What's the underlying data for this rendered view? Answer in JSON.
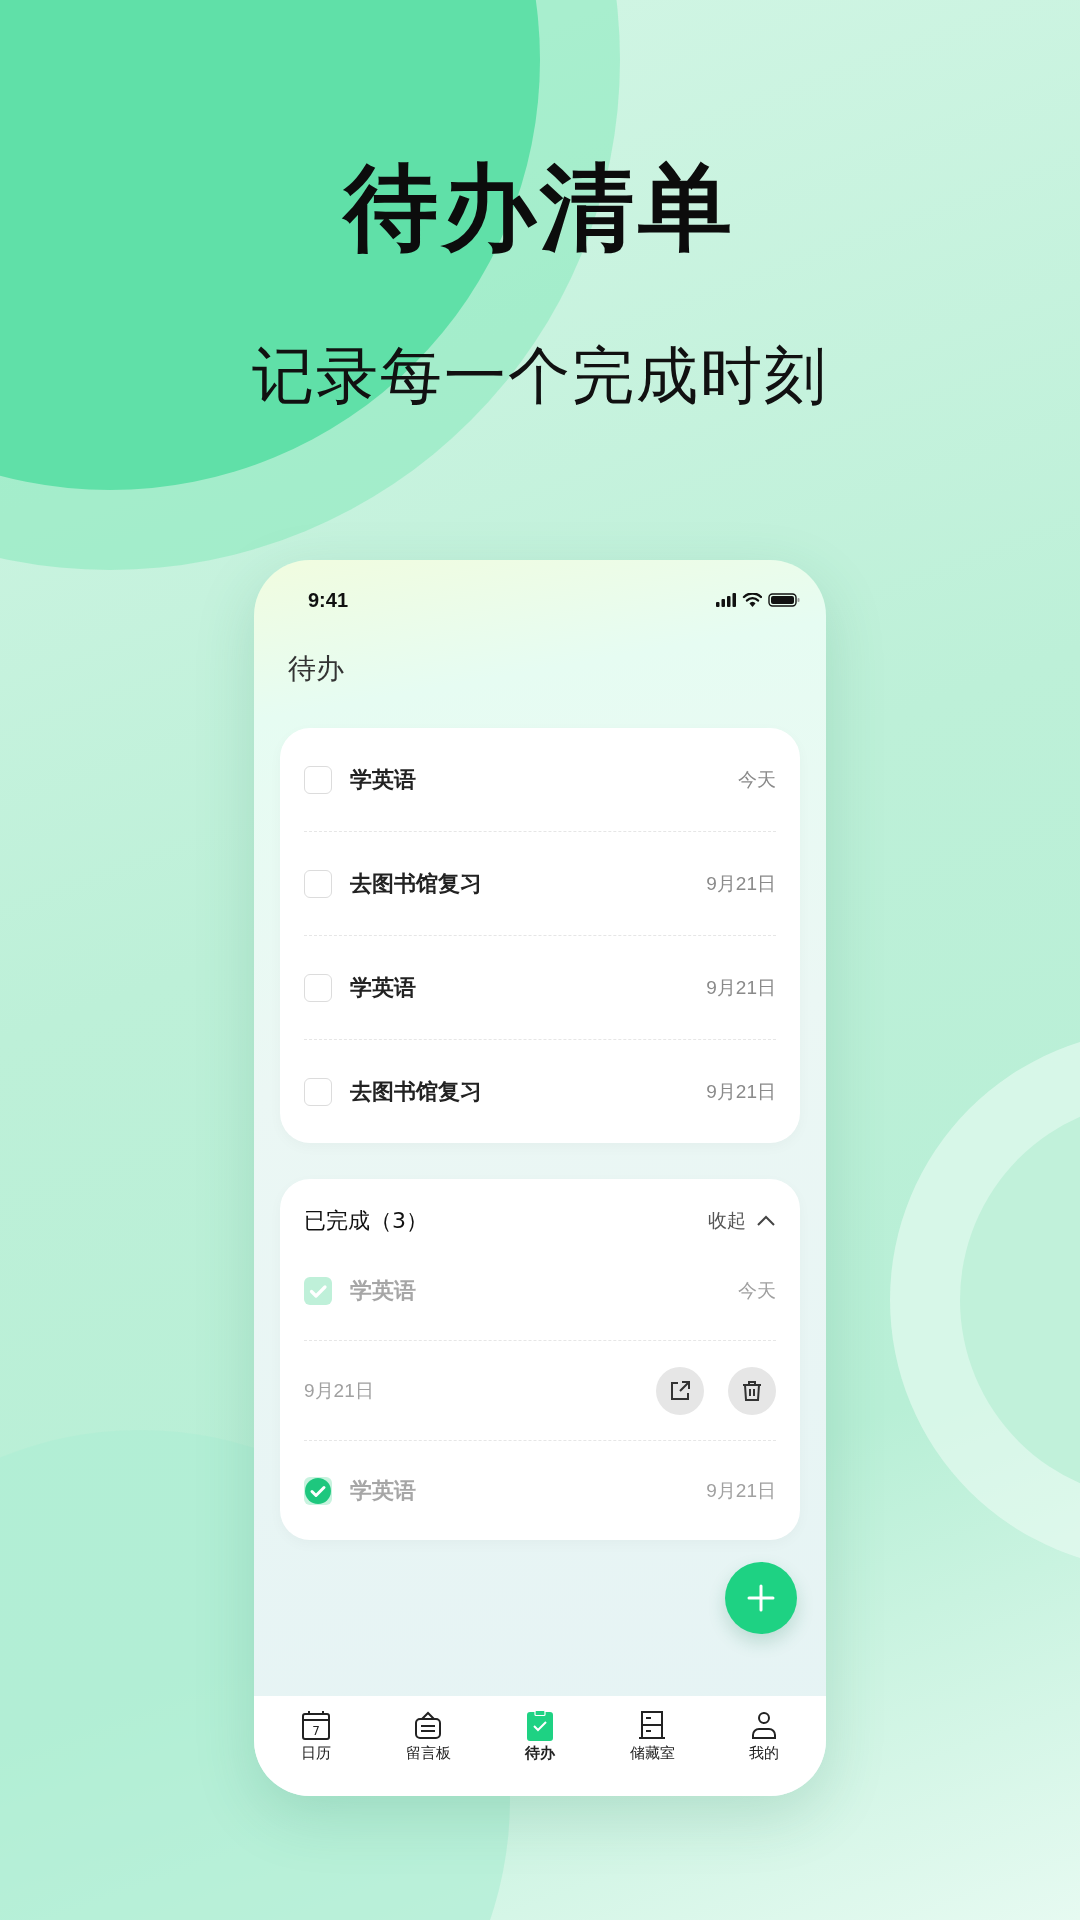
{
  "headline": "待办清单",
  "subtitle": "记录每一个完成时刻",
  "status_bar": {
    "time": "9:41"
  },
  "page_title": "待办",
  "todo_items": [
    {
      "title": "学英语",
      "date": "今天",
      "checked": false
    },
    {
      "title": "去图书馆复习",
      "date": "9月21日",
      "checked": false
    },
    {
      "title": "学英语",
      "date": "9月21日",
      "checked": false
    },
    {
      "title": "去图书馆复习",
      "date": "9月21日",
      "checked": false
    }
  ],
  "completed": {
    "title": "已完成（3）",
    "toggle": "收起",
    "expanded": true,
    "items": [
      {
        "kind": "fading",
        "title": "学英语",
        "date": "今天",
        "checked": true
      },
      {
        "kind": "swiped",
        "date": "9月21日"
      },
      {
        "kind": "done",
        "title": "学英语",
        "date": "9月21日",
        "checked": true
      }
    ]
  },
  "nav": [
    {
      "label": "日历",
      "icon_text": "7",
      "selected": false
    },
    {
      "label": "留言板",
      "selected": false
    },
    {
      "label": "待办",
      "selected": true
    },
    {
      "label": "储藏室",
      "selected": false
    },
    {
      "label": "我的",
      "selected": false
    }
  ]
}
